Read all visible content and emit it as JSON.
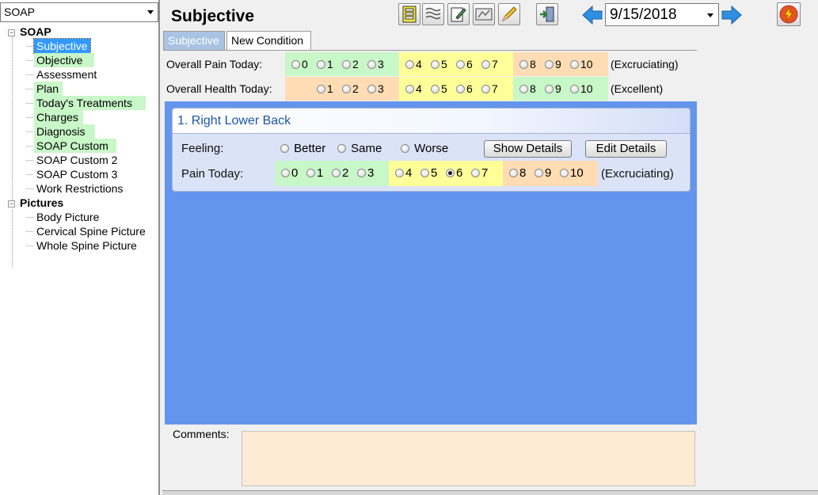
{
  "sidebar": {
    "module_select": "SOAP",
    "tree": [
      {
        "label": "SOAP",
        "items": [
          {
            "label": "Subjective"
          },
          {
            "label": "Objective"
          },
          {
            "label": "Assessment"
          },
          {
            "label": "Plan"
          },
          {
            "label": "Today's Treatments"
          },
          {
            "label": "Charges"
          },
          {
            "label": "Diagnosis"
          },
          {
            "label": "SOAP Custom"
          },
          {
            "label": "SOAP Custom 2"
          },
          {
            "label": "SOAP Custom 3"
          },
          {
            "label": "Work Restrictions"
          }
        ]
      },
      {
        "label": "Pictures",
        "items": [
          {
            "label": "Body Picture"
          },
          {
            "label": "Cervical Spine Picture"
          },
          {
            "label": "Whole Spine Picture"
          }
        ]
      }
    ],
    "selected_item": "Subjective",
    "highlighted_items": [
      "Objective",
      "Plan",
      "Today's Treatments",
      "Charges",
      "Diagnosis",
      "SOAP Custom"
    ]
  },
  "header": {
    "title": "Subjective",
    "date": "9/15/2018",
    "toolbar_icons": [
      "form-icon",
      "notes-icon",
      "edit-note-icon",
      "xray-icon",
      "pencil-icon",
      "exit-icon",
      "prev-arrow-icon",
      "next-arrow-icon",
      "lightning-icon"
    ]
  },
  "tabs": [
    {
      "label": "Subjective"
    },
    {
      "label": "New Condition"
    }
  ],
  "overall": {
    "pain_label": "Overall Pain Today:",
    "pain_extreme": "(Excruciating)",
    "health_label": "Overall Health Today:",
    "health_extreme": "(Excellent)",
    "digits": [
      "0",
      "1",
      "2",
      "3",
      "4",
      "5",
      "6",
      "7",
      "8",
      "9",
      "10"
    ]
  },
  "condition": {
    "title": "1. Right Lower Back",
    "feeling_label": "Feeling:",
    "feeling_options": [
      "Better",
      "Same",
      "Worse"
    ],
    "show_details": "Show Details",
    "edit_details": "Edit Details",
    "pain_label": "Pain Today:",
    "pain_selected": "6",
    "pain_extreme": "(Excruciating)"
  },
  "comments": {
    "label": "Comments:",
    "value": ""
  },
  "colors": {
    "low_zone": "#c8f7c8",
    "mid_zone": "#ffff99",
    "high_zone": "#ffdcb4",
    "panel_blue": "#6495ed",
    "selected": "#3399ff"
  }
}
